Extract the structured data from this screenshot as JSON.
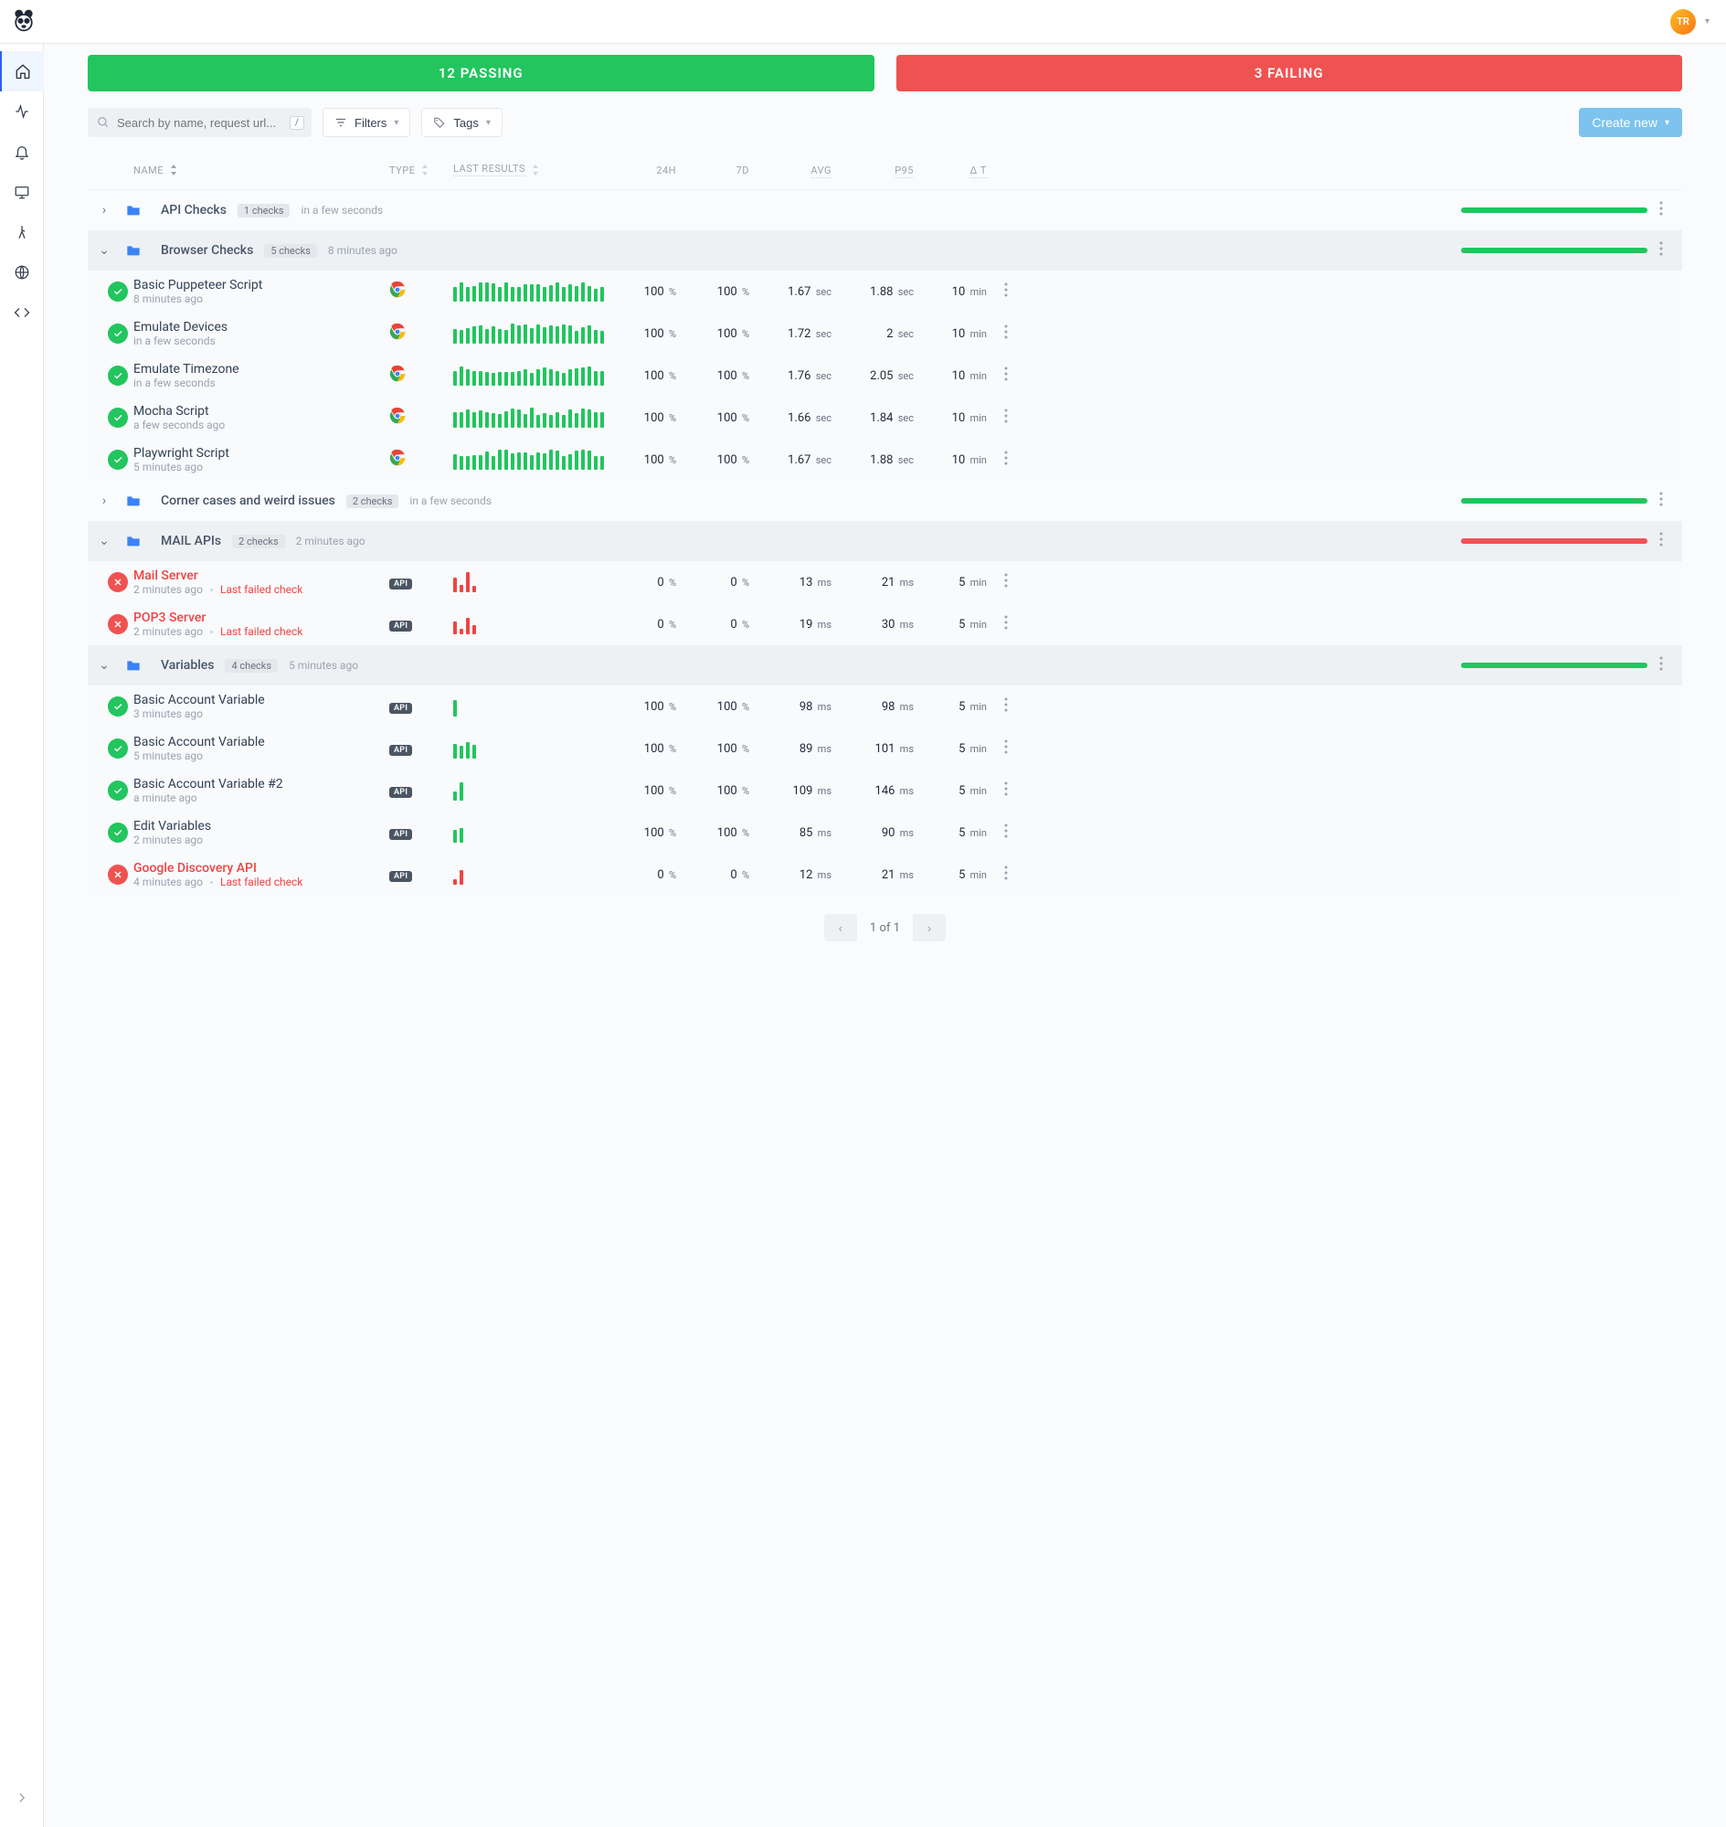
{
  "summary": {
    "passing_label": "12 PASSING",
    "failing_label": "3 FAILING"
  },
  "toolbar": {
    "search_placeholder": "Search by name, request url...",
    "search_kbd": "/",
    "filters_label": "Filters",
    "tags_label": "Tags",
    "create_label": "Create new"
  },
  "columns": {
    "name": "NAME",
    "type": "TYPE",
    "last_results": "LAST RESULTS",
    "h24": "24H",
    "d7": "7D",
    "avg": "AVG",
    "p95": "P95",
    "dt": "Δ T"
  },
  "type_labels": {
    "api": "API"
  },
  "groups": [
    {
      "id": "api-checks",
      "title": "API Checks",
      "expanded": false,
      "count_label": "1 checks",
      "when": "in a few seconds",
      "bar": "pass",
      "checks": []
    },
    {
      "id": "browser-checks",
      "title": "Browser Checks",
      "expanded": true,
      "count_label": "5 checks",
      "when": "8 minutes ago",
      "bar": "pass",
      "checks": [
        {
          "status": "pass",
          "type": "chrome",
          "name": "Basic Puppeteer Script",
          "when": "8 minutes ago",
          "h24": "100",
          "d7": "100",
          "avg": "1.67",
          "avg_u": "sec",
          "p95": "1.88",
          "p95_u": "sec",
          "dt": "10",
          "dt_u": "min",
          "spark": "full"
        },
        {
          "status": "pass",
          "type": "chrome",
          "name": "Emulate Devices",
          "when": "in a few seconds",
          "h24": "100",
          "d7": "100",
          "avg": "1.72",
          "avg_u": "sec",
          "p95": "2",
          "p95_u": "sec",
          "dt": "10",
          "dt_u": "min",
          "spark": "full"
        },
        {
          "status": "pass",
          "type": "chrome",
          "name": "Emulate Timezone",
          "when": "in a few seconds",
          "h24": "100",
          "d7": "100",
          "avg": "1.76",
          "avg_u": "sec",
          "p95": "2.05",
          "p95_u": "sec",
          "dt": "10",
          "dt_u": "min",
          "spark": "full"
        },
        {
          "status": "pass",
          "type": "chrome",
          "name": "Mocha Script",
          "when": "a few seconds ago",
          "h24": "100",
          "d7": "100",
          "avg": "1.66",
          "avg_u": "sec",
          "p95": "1.84",
          "p95_u": "sec",
          "dt": "10",
          "dt_u": "min",
          "spark": "full"
        },
        {
          "status": "pass",
          "type": "chrome",
          "name": "Playwright Script",
          "when": "5 minutes ago",
          "h24": "100",
          "d7": "100",
          "avg": "1.67",
          "avg_u": "sec",
          "p95": "1.88",
          "p95_u": "sec",
          "dt": "10",
          "dt_u": "min",
          "spark": "full"
        }
      ]
    },
    {
      "id": "corner-cases",
      "title": "Corner cases and weird issues",
      "expanded": false,
      "count_label": "2 checks",
      "when": "in a few seconds",
      "bar": "pass",
      "checks": []
    },
    {
      "id": "mail-apis",
      "title": "MAIL APIs",
      "expanded": true,
      "count_label": "2 checks",
      "when": "2 minutes ago",
      "bar": "fail",
      "checks": [
        {
          "status": "fail",
          "type": "api",
          "name": "Mail Server",
          "when": "2 minutes ago",
          "last_failed": "Last failed check",
          "h24": "0",
          "d7": "0",
          "avg": "13",
          "avg_u": "ms",
          "p95": "21",
          "p95_u": "ms",
          "dt": "5",
          "dt_u": "min",
          "spark": "fail1"
        },
        {
          "status": "fail",
          "type": "api",
          "name": "POP3 Server",
          "when": "2 minutes ago",
          "last_failed": "Last failed check",
          "h24": "0",
          "d7": "0",
          "avg": "19",
          "avg_u": "ms",
          "p95": "30",
          "p95_u": "ms",
          "dt": "5",
          "dt_u": "min",
          "spark": "fail2"
        }
      ]
    },
    {
      "id": "variables",
      "title": "Variables",
      "expanded": true,
      "count_label": "4 checks",
      "when": "5 minutes ago",
      "bar": "pass",
      "checks": [
        {
          "status": "pass",
          "type": "api",
          "name": "Basic Account Variable",
          "when": "3 minutes ago",
          "h24": "100",
          "d7": "100",
          "avg": "98",
          "avg_u": "ms",
          "p95": "98",
          "p95_u": "ms",
          "dt": "5",
          "dt_u": "min",
          "spark": "g1"
        },
        {
          "status": "pass",
          "type": "api",
          "name": "Basic Account Variable",
          "when": "5 minutes ago",
          "h24": "100",
          "d7": "100",
          "avg": "89",
          "avg_u": "ms",
          "p95": "101",
          "p95_u": "ms",
          "dt": "5",
          "dt_u": "min",
          "spark": "g4"
        },
        {
          "status": "pass",
          "type": "api",
          "name": "Basic Account Variable #2",
          "when": "a minute ago",
          "h24": "100",
          "d7": "100",
          "avg": "109",
          "avg_u": "ms",
          "p95": "146",
          "p95_u": "ms",
          "dt": "5",
          "dt_u": "min",
          "spark": "g2"
        },
        {
          "status": "pass",
          "type": "api",
          "name": "Edit Variables",
          "when": "2 minutes ago",
          "h24": "100",
          "d7": "100",
          "avg": "85",
          "avg_u": "ms",
          "p95": "90",
          "p95_u": "ms",
          "dt": "5",
          "dt_u": "min",
          "spark": "g2b"
        },
        {
          "status": "fail",
          "type": "api",
          "name": "Google Discovery API",
          "when": "4 minutes ago",
          "last_failed": "Last failed check",
          "h24": "0",
          "d7": "0",
          "avg": "12",
          "avg_u": "ms",
          "p95": "21",
          "p95_u": "ms",
          "dt": "5",
          "dt_u": "min",
          "spark": "failg"
        }
      ]
    }
  ],
  "pagination": {
    "label": "1 of 1"
  }
}
